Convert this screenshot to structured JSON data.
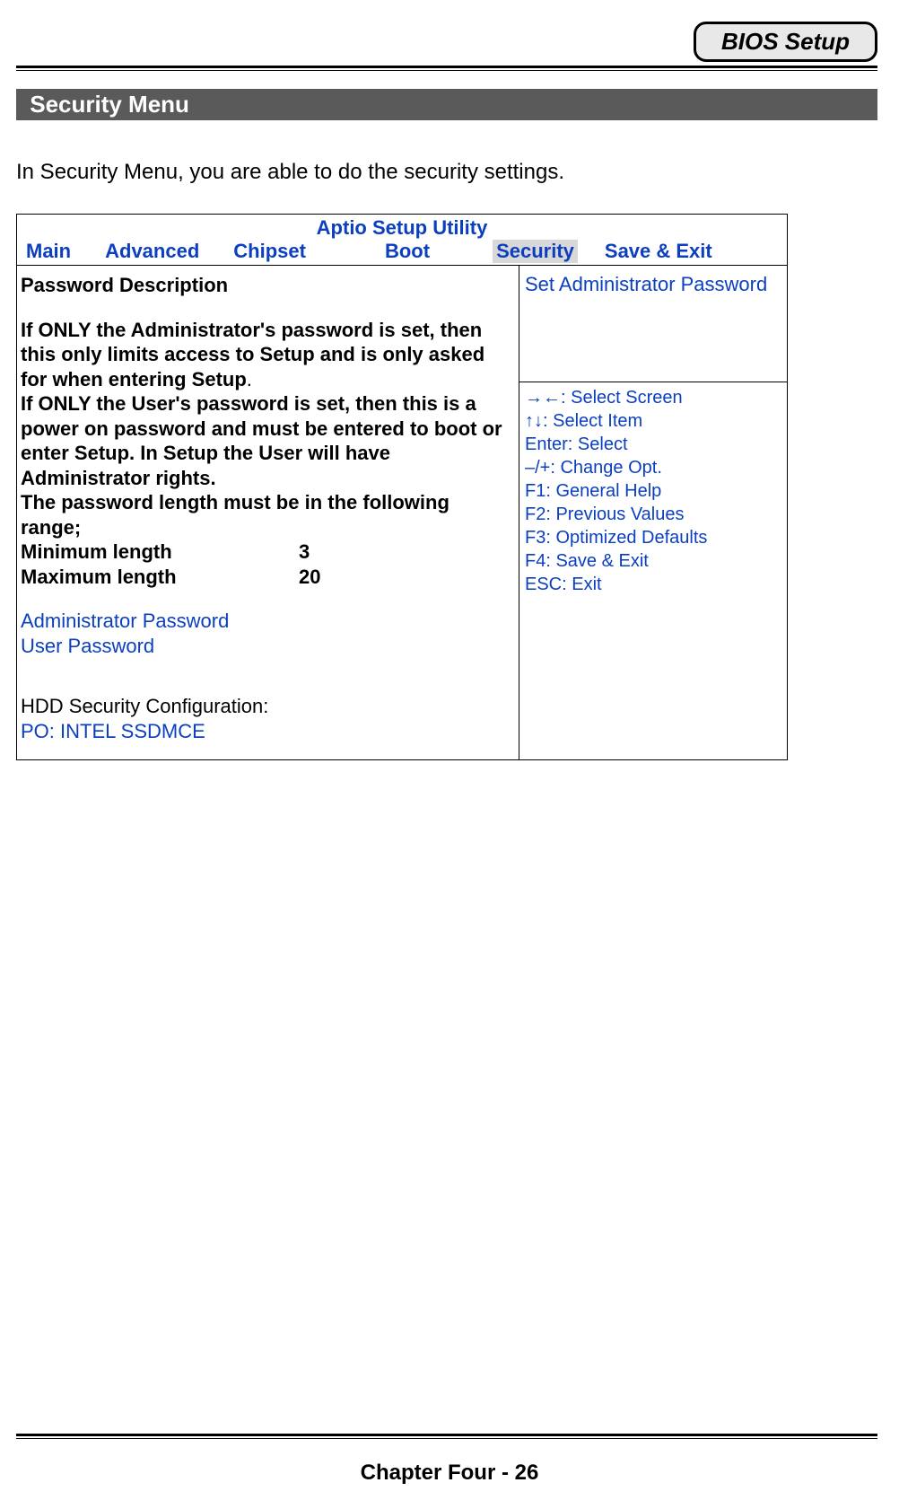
{
  "header": {
    "tab": "BIOS Setup"
  },
  "section_title": "Security Menu",
  "intro": "In Security Menu, you are able to do the security settings.",
  "bios": {
    "utility_title": "Aptio Setup Utility",
    "tabs": {
      "main": "Main",
      "advanced": "Advanced",
      "chipset": "Chipset",
      "boot": "Boot",
      "security": "Security",
      "save_exit": "Save & Exit"
    },
    "left": {
      "heading": "Password Description",
      "para1": "If ONLY the Administrator's password is set, then this only limits access to Setup and is only asked for when entering Setup",
      "para1_dot": ".",
      "para2": "If ONLY the User's password is set, then this is a power on password and must be entered to boot or enter Setup. In Setup the User will have Administrator rights.",
      "para3": "The password length must be in the following range;",
      "min_label": "Minimum length",
      "min_value": "3",
      "max_label": "Maximum length",
      "max_value": "20",
      "admin_pw": "Administrator Password",
      "user_pw": "User Password",
      "hdd_label": "HDD Security Configuration:",
      "hdd_item": "PO: INTEL SSDMCE"
    },
    "right": {
      "help_top": "Set Administrator Password",
      "hints": {
        "h1": "→←: Select Screen",
        "h2": "↑↓: Select Item",
        "h3": "Enter: Select",
        "h4": "–/+: Change Opt.",
        "h5": "F1: General Help",
        "h6": "F2: Previous Values",
        "h7": "F3: Optimized Defaults",
        "h8": "F4: Save & Exit",
        "h9": "ESC: Exit"
      }
    }
  },
  "footer": "Chapter Four - 26"
}
